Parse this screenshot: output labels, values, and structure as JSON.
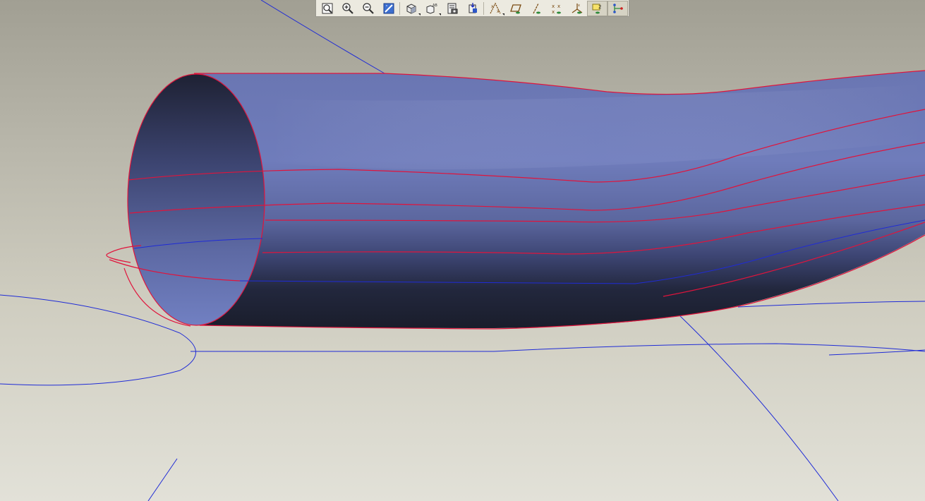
{
  "window": {
    "kind": "3D CAD model viewport",
    "background_top": "#a19f93",
    "background_bottom": "#e2e1d8"
  },
  "model": {
    "surface_color": "#6e7bb8",
    "surface_dark": "#1c1f2f",
    "edge_color": "#e0143c",
    "datum_curve_color": "#1f2bd6"
  },
  "toolbar": {
    "buttons": [
      {
        "name": "refit-button",
        "icon": "refit-icon",
        "active": false
      },
      {
        "name": "zoom-in-button",
        "icon": "zoom-in-icon",
        "active": false
      },
      {
        "name": "zoom-out-button",
        "icon": "zoom-out-icon",
        "active": false
      },
      {
        "name": "repaint-button",
        "icon": "repaint-icon",
        "active": false
      },
      {
        "name": "display-style-button",
        "icon": "shaded-cube-icon",
        "active": false,
        "dropdown": true
      },
      {
        "name": "saved-views-button",
        "icon": "saved-views-icon",
        "active": false,
        "dropdown": true
      },
      {
        "name": "view-manager-button",
        "icon": "view-manager-icon",
        "active": false
      },
      {
        "name": "reorient-button",
        "icon": "reorient-icon",
        "active": false
      },
      {
        "name": "datum-display-button",
        "icon": "datum-display-icon",
        "active": false,
        "dropdown": true
      },
      {
        "name": "plane-display-button",
        "icon": "datum-plane-icon",
        "active": false
      },
      {
        "name": "axis-display-button",
        "icon": "datum-axis-icon",
        "active": false
      },
      {
        "name": "point-display-button",
        "icon": "datum-point-icon",
        "active": false
      },
      {
        "name": "csys-display-button",
        "icon": "csys-icon",
        "active": false
      },
      {
        "name": "annotation-display-button",
        "icon": "annotation-icon",
        "active": true
      },
      {
        "name": "spin-center-button",
        "icon": "spin-center-icon",
        "active": true
      }
    ]
  }
}
